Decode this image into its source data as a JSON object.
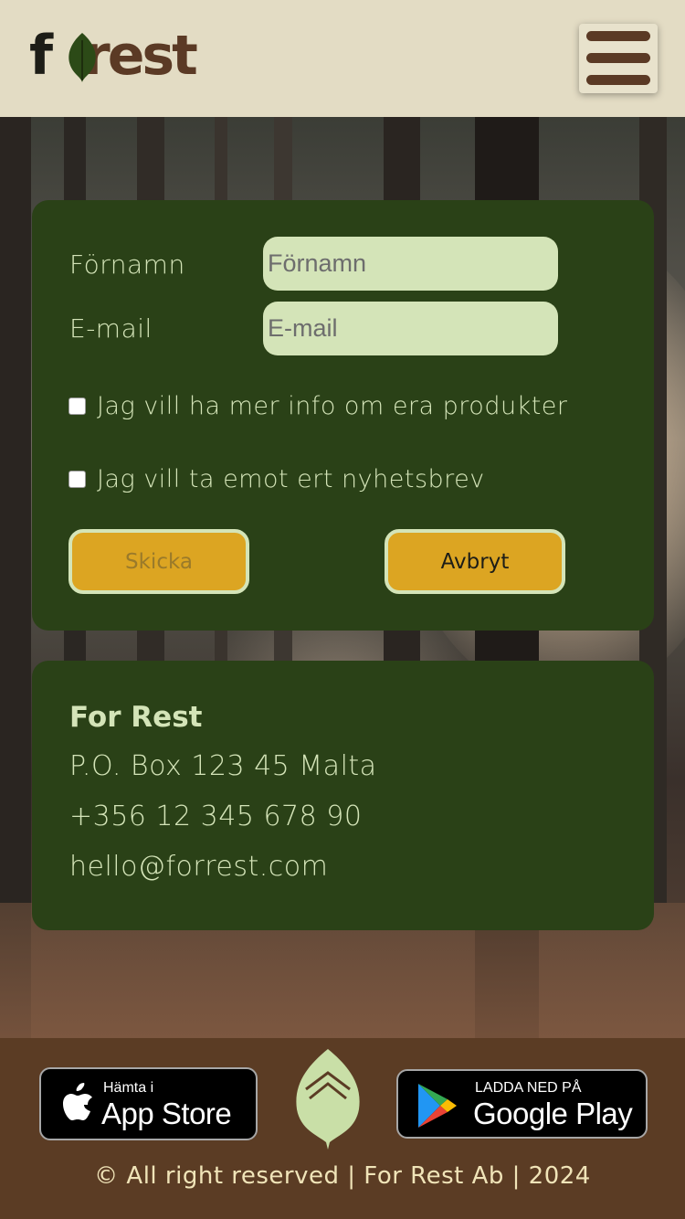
{
  "brand": {
    "logo_first": "f",
    "logo_rest": "rest"
  },
  "header": {
    "menu_icon": "hamburger-menu-icon"
  },
  "form": {
    "firstname_label": "Förnamn",
    "firstname_placeholder": "Förnamn",
    "firstname_value": "",
    "email_label": "E-mail",
    "email_placeholder": "E-mail",
    "email_value": "",
    "checkbox_info_label": "Jag vill ha mer info om era produkter",
    "checkbox_info_checked": false,
    "checkbox_newsletter_label": "Jag vill ta emot ert nyhetsbrev",
    "checkbox_newsletter_checked": false,
    "submit_label": "Skicka",
    "cancel_label": "Avbryt"
  },
  "contact": {
    "company": "For Rest",
    "address": "P.O. Box 123 45 Malta",
    "phone": "+356 12 345 678 90",
    "email": "hello@forrest.com"
  },
  "footer": {
    "appstore_small": "Hämta i",
    "appstore_big": "App Store",
    "googleplay_small": "LADDA NED PÅ",
    "googleplay_big": "Google Play",
    "copyright": "© All right reserved | For Rest Ab | 2024"
  },
  "colors": {
    "header_bg": "#e3dcc4",
    "card_bg": "#2a4117",
    "card_text": "#d4e4b8",
    "button_bg": "#dca522",
    "footer_bg": "#5b3c24",
    "brand_brown": "#5b3a25"
  }
}
